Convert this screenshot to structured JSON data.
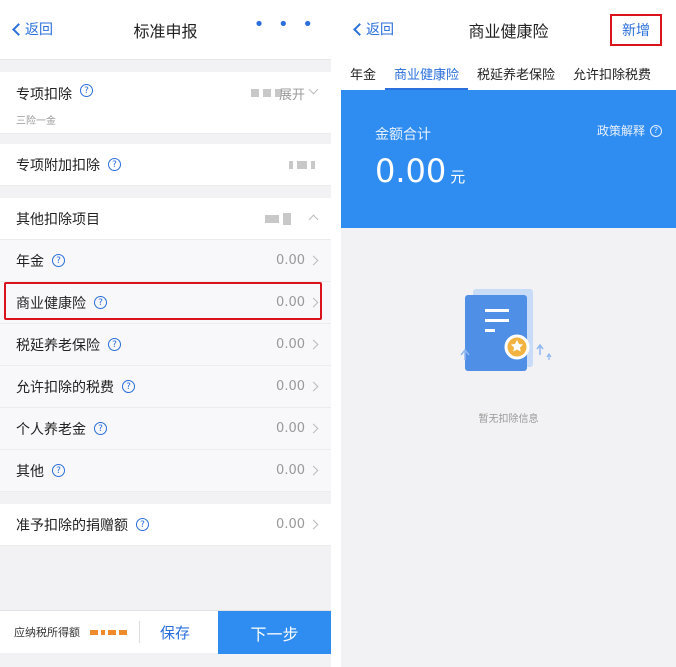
{
  "left": {
    "nav": {
      "back": "返回",
      "title": "标准申报",
      "more": "• • •"
    },
    "special_deduction": {
      "label": "专项扣除",
      "sub": "三险一金",
      "toggle": "展开"
    },
    "special_additional": {
      "label": "专项附加扣除"
    },
    "other_items": {
      "label": "其他扣除项目"
    },
    "items": [
      {
        "label": "年金",
        "value": "0.00"
      },
      {
        "label": "商业健康险",
        "value": "0.00"
      },
      {
        "label": "税延养老保险",
        "value": "0.00"
      },
      {
        "label": "允许扣除的税费",
        "value": "0.00"
      },
      {
        "label": "个人养老金",
        "value": "0.00"
      },
      {
        "label": "其他",
        "value": "0.00"
      }
    ],
    "donation": {
      "label": "准予扣除的捐赠额",
      "value": "0.00"
    },
    "bottom": {
      "tax_label": "应纳税所得额",
      "save": "保存",
      "next": "下一步"
    },
    "help_glyph": "?"
  },
  "right": {
    "nav": {
      "back": "返回",
      "title": "商业健康险",
      "add": "新增"
    },
    "tabs": [
      "年金",
      "商业健康险",
      "税延养老保险",
      "允许扣除税费"
    ],
    "active_tab": 1,
    "hero": {
      "label": "金额合计",
      "amount": "0.00",
      "unit": "元",
      "policy": "政策解释"
    },
    "empty_text": "暂无扣除信息"
  },
  "colors": {
    "brand": "#2f8cf0",
    "highlight": "#d9121b"
  }
}
